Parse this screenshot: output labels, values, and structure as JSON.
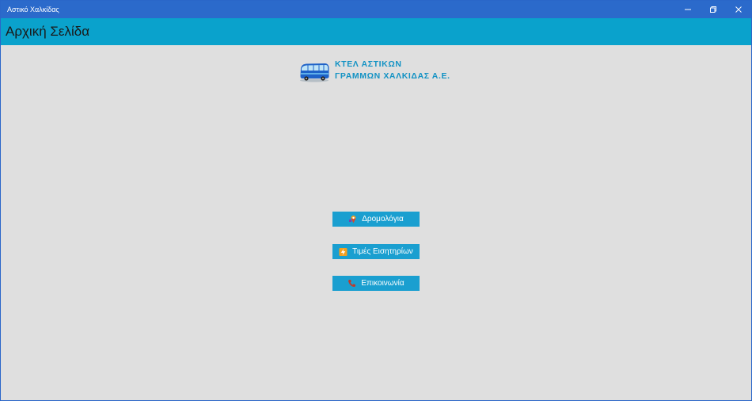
{
  "window": {
    "title": "Αστικό Χαλκίδας",
    "controls": [
      "minimize-icon",
      "restore-icon",
      "close-icon"
    ]
  },
  "header": {
    "title": "Αρχική Σελίδα"
  },
  "logo": {
    "line1": "ΚΤΕΛ ΑΣΤΙΚΩΝ",
    "line2": "ΓΡΑΜΜΩΝ ΧΑΛΚΙΔΑΣ Α.Ε.",
    "icon": "bus-icon"
  },
  "buttons": [
    {
      "label": "Δρομολόγια",
      "icon": "route-pin-icon"
    },
    {
      "label": "Τιμές Εισητηρίων",
      "icon": "ticket-icon"
    },
    {
      "label": "Επικοινωνία",
      "icon": "phone-icon"
    }
  ],
  "colors": {
    "titlebar": "#2b6acb",
    "header": "#0aa2cc",
    "button": "#1a9fd0",
    "logo_text": "#1292c4",
    "background": "#dfdfdf"
  }
}
